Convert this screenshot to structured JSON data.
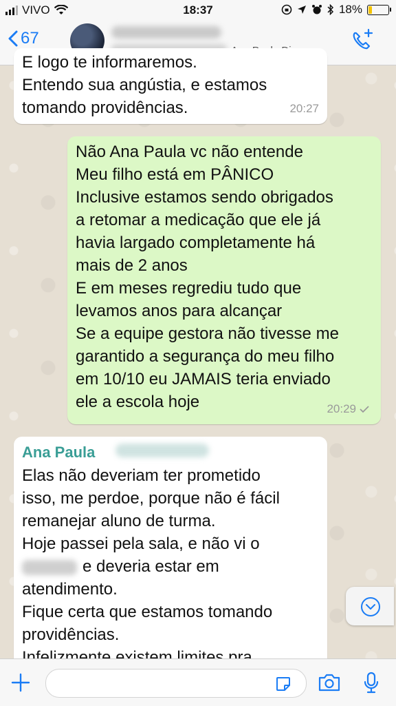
{
  "status_bar": {
    "carrier": "VIVO",
    "time": "18:37",
    "battery_percent": "18%",
    "battery_level": 0.18,
    "battery_color": "#f5c400"
  },
  "nav": {
    "back_count": "67",
    "chat_subtitle": "Ana Paula Direcao...",
    "accent_color": "#1a7cf5",
    "icons": [
      "chevron-left-icon",
      "avatar",
      "add-call-icon"
    ]
  },
  "messages": [
    {
      "direction": "incoming",
      "lines": [
        "E logo te informaremos.",
        "Entendo sua angústia, e estamos",
        "tomando providências."
      ],
      "time": "20:27"
    },
    {
      "direction": "outgoing",
      "lines": [
        "Não Ana Paula vc não entende",
        "Meu filho está em PÂNICO",
        "Inclusive estamos sendo obrigados",
        "a retomar a medicação que ele já",
        "havia largado completamente há",
        "mais de 2 anos",
        "E em meses regrediu tudo que",
        "levamos anos para alcançar",
        "Se a equipe gestora não tivesse me",
        "garantido a segurança do meu filho",
        "em 10/10 eu JAMAIS teria enviado",
        "ele a escola hoje"
      ],
      "time": "20:29"
    },
    {
      "direction": "incoming",
      "sender": "Ana Paula",
      "lines": [
        "Elas não deveriam ter prometido",
        "isso, me perdoe, porque não é fácil",
        "remanejar aluno de turma.",
        "Hoje passei pela sala, e não vi o",
        "e deveria estar em",
        "atendimento.",
        "Fique certa que estamos tomando",
        "providências.",
        "Infelizmente existem limites pra"
      ]
    }
  ],
  "colors": {
    "outgoing_bubble": "#dcf8c6",
    "incoming_bubble": "#ffffff",
    "sender_name": "#3a9e96"
  },
  "input_bar": {
    "message_placeholder": "",
    "icons": [
      "plus-icon",
      "sticker-icon",
      "camera-icon",
      "microphone-icon"
    ]
  }
}
